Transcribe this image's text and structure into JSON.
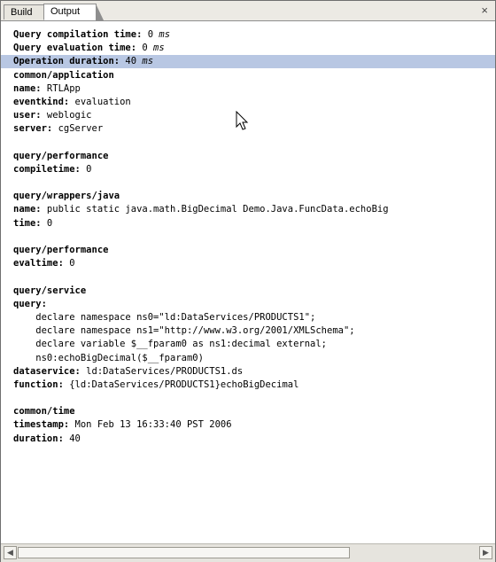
{
  "tabs": {
    "build": "Build",
    "output": "Output"
  },
  "close": "×",
  "lines": [
    {
      "key": "Query compilation time:",
      "value": " 0 ",
      "unit": "ms"
    },
    {
      "key": "Query evaluation time:",
      "value": " 0 ",
      "unit": "ms"
    },
    {
      "key": "Operation duration:",
      "value": " 40 ",
      "unit": "ms"
    },
    {
      "key": "common/application",
      "value": "",
      "unit": ""
    },
    {
      "key": "name:",
      "value": " RTLApp",
      "unit": ""
    },
    {
      "key": "eventkind:",
      "value": " evaluation",
      "unit": ""
    },
    {
      "key": "user:",
      "value": " weblogic",
      "unit": ""
    },
    {
      "key": "server:",
      "value": " cgServer",
      "unit": ""
    },
    {
      "key": "",
      "value": "",
      "unit": ""
    },
    {
      "key": "query/performance",
      "value": "",
      "unit": ""
    },
    {
      "key": "compiletime:",
      "value": " 0",
      "unit": ""
    },
    {
      "key": "",
      "value": "",
      "unit": ""
    },
    {
      "key": "query/wrappers/java",
      "value": "",
      "unit": ""
    },
    {
      "key": "name:",
      "value": " public static java.math.BigDecimal Demo.Java.FuncData.echoBig",
      "unit": ""
    },
    {
      "key": "time:",
      "value": " 0",
      "unit": ""
    },
    {
      "key": "",
      "value": "",
      "unit": ""
    },
    {
      "key": "query/performance",
      "value": "",
      "unit": ""
    },
    {
      "key": "evaltime:",
      "value": " 0",
      "unit": ""
    },
    {
      "key": "",
      "value": "",
      "unit": ""
    },
    {
      "key": "query/service",
      "value": "",
      "unit": ""
    },
    {
      "key": "query:",
      "value": "",
      "unit": ""
    },
    {
      "key": "",
      "value": "    declare namespace ns0=\"ld:DataServices/PRODUCTS1\";",
      "unit": ""
    },
    {
      "key": "",
      "value": "    declare namespace ns1=\"http://www.w3.org/2001/XMLSchema\";",
      "unit": ""
    },
    {
      "key": "",
      "value": "    declare variable $__fparam0 as ns1:decimal external;",
      "unit": ""
    },
    {
      "key": "",
      "value": "    ns0:echoBigDecimal($__fparam0)",
      "unit": ""
    },
    {
      "key": "dataservice:",
      "value": " ld:DataServices/PRODUCTS1.ds",
      "unit": ""
    },
    {
      "key": "function:",
      "value": " {ld:DataServices/PRODUCTS1}echoBigDecimal",
      "unit": ""
    },
    {
      "key": "",
      "value": "",
      "unit": ""
    },
    {
      "key": "common/time",
      "value": "",
      "unit": ""
    },
    {
      "key": "timestamp:",
      "value": " Mon Feb 13 16:33:40 PST 2006",
      "unit": ""
    },
    {
      "key": "duration:",
      "value": " 40",
      "unit": ""
    }
  ],
  "scroll": {
    "left": "◀",
    "right": "▶"
  }
}
